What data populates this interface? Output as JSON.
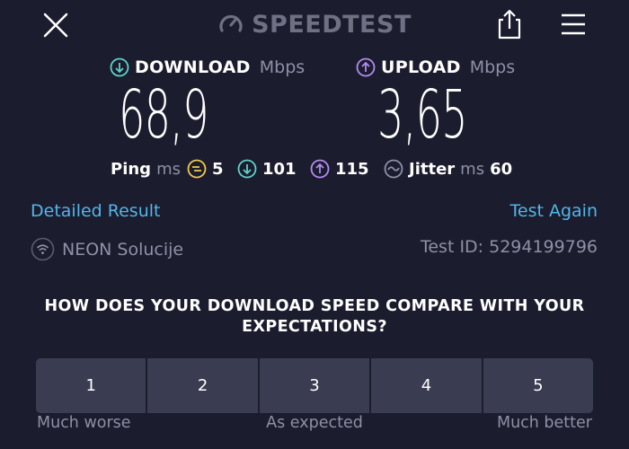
{
  "header": {
    "logo_text": "SPEEDTEST",
    "close_icon": "close-icon",
    "share_icon": "share-icon",
    "menu_icon": "hamburger-menu-icon"
  },
  "download": {
    "label": "DOWNLOAD",
    "unit": "Mbps",
    "value": "68,9",
    "icon_color": "#5fd3c8"
  },
  "upload": {
    "label": "UPLOAD",
    "unit": "Mbps",
    "value": "3,65",
    "icon_color": "#b48cf0"
  },
  "ping": {
    "label": "Ping",
    "unit": "ms",
    "idle": "5",
    "download": "101",
    "upload": "115",
    "idle_color": "#f2c94c"
  },
  "jitter": {
    "label": "Jitter",
    "unit": "ms",
    "value": "60"
  },
  "links": {
    "detailed": "Detailed Result",
    "again": "Test Again"
  },
  "provider": {
    "name": "NEON Solucije",
    "icon": "wifi-icon"
  },
  "test_id": "Test ID: 5294199796",
  "survey": {
    "question": "HOW DOES YOUR DOWNLOAD SPEED COMPARE WITH YOUR EXPECTATIONS?",
    "options": [
      "1",
      "2",
      "3",
      "4",
      "5"
    ],
    "low_label": "Much worse",
    "mid_label": "As expected",
    "high_label": "Much better"
  },
  "colors": {
    "background": "#1b1c2e",
    "link": "#54b5e8",
    "button": "#3a3c52",
    "muted": "#8e90a4"
  }
}
